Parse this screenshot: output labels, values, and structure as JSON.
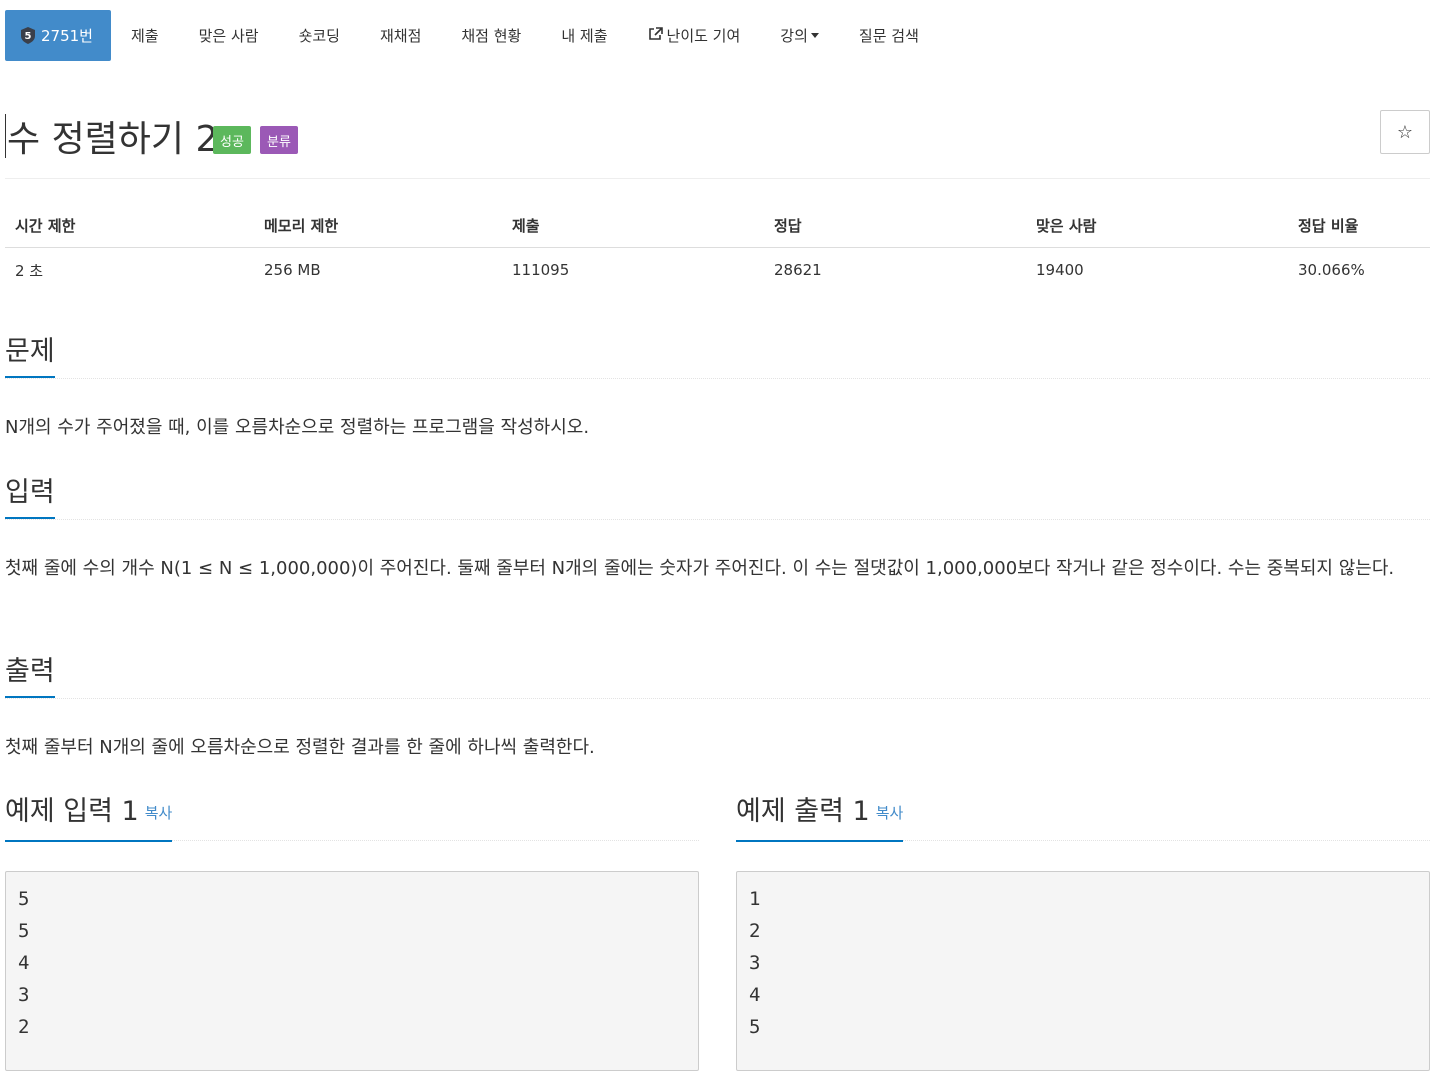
{
  "nav": {
    "problem_tab": {
      "badge": "5",
      "label": "2751번"
    },
    "items": [
      {
        "label": "제출"
      },
      {
        "label": "맞은 사람"
      },
      {
        "label": "숏코딩"
      },
      {
        "label": "재채점"
      },
      {
        "label": "채점 현황"
      },
      {
        "label": "내 제출"
      },
      {
        "label": "난이도 기여",
        "icon": "external-link-icon"
      },
      {
        "label": "강의",
        "icon": "caret-down-icon"
      },
      {
        "label": "질문 검색"
      }
    ]
  },
  "problem": {
    "title": "수 정렬하기 2",
    "labels": {
      "success": "성공",
      "classification": "분류"
    },
    "star": "☆"
  },
  "stats": {
    "headers": [
      "시간 제한",
      "메모리 제한",
      "제출",
      "정답",
      "맞은 사람",
      "정답 비율"
    ],
    "values": [
      "2 초",
      "256 MB",
      "111095",
      "28621",
      "19400",
      "30.066%"
    ]
  },
  "sections": {
    "problem": {
      "title": "문제",
      "body": "N개의 수가 주어졌을 때, 이를 오름차순으로 정렬하는 프로그램을 작성하시오."
    },
    "input": {
      "title": "입력",
      "body": "첫째 줄에 수의 개수 N(1 ≤ N ≤ 1,000,000)이 주어진다. 둘째 줄부터 N개의 줄에는 숫자가 주어진다. 이 수는 절댓값이 1,000,000보다 작거나 같은 정수이다. 수는 중복되지 않는다."
    },
    "output": {
      "title": "출력",
      "body": "첫째 줄부터 N개의 줄에 오름차순으로 정렬한 결과를 한 줄에 하나씩 출력한다."
    }
  },
  "samples": {
    "input": {
      "title": "예제 입력 1",
      "copy": "복사",
      "lines": [
        "5",
        "5",
        "4",
        "3",
        "2"
      ]
    },
    "output": {
      "title": "예제 출력 1",
      "copy": "복사",
      "lines": [
        "1",
        "2",
        "3",
        "4",
        "5"
      ]
    }
  },
  "colors": {
    "primary": "#428bca",
    "success": "#5cb85c",
    "classification": "#9b59b6",
    "underline": "#0076c0"
  }
}
